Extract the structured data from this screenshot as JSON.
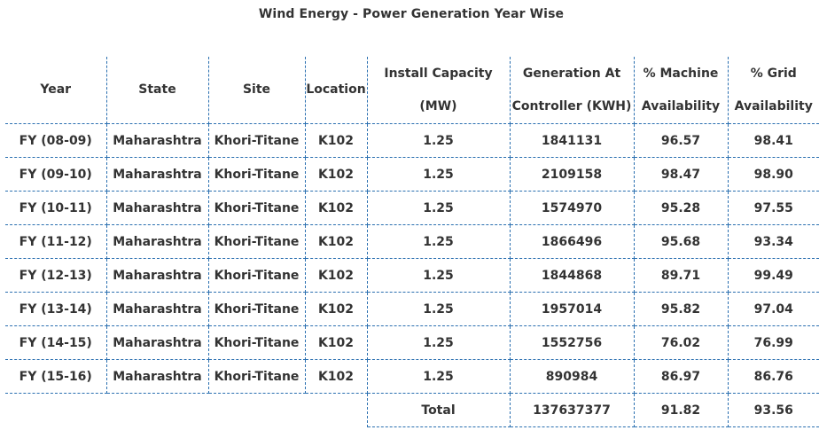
{
  "title": "Wind Energy - Power Generation Year Wise",
  "headers": {
    "year": "Year",
    "state": "State",
    "site": "Site",
    "location": "Location",
    "capacity_line1": "Install Capacity",
    "capacity_line2": "(MW)",
    "generation_line1": "Generation At",
    "generation_line2": "Controller (KWH)",
    "machine_line1": "% Machine",
    "machine_line2": "Availability",
    "grid_line1": "% Grid",
    "grid_line2": "Availability"
  },
  "rows": [
    {
      "year": "FY (08-09)",
      "state": "Maharashtra",
      "site": "Khori-Titane",
      "location": "K102",
      "capacity": "1.25",
      "generation": "1841131",
      "machine": "96.57",
      "grid": "98.41"
    },
    {
      "year": "FY (09-10)",
      "state": "Maharashtra",
      "site": "Khori-Titane",
      "location": "K102",
      "capacity": "1.25",
      "generation": "2109158",
      "machine": "98.47",
      "grid": "98.90"
    },
    {
      "year": "FY (10-11)",
      "state": "Maharashtra",
      "site": "Khori-Titane",
      "location": "K102",
      "capacity": "1.25",
      "generation": "1574970",
      "machine": "95.28",
      "grid": "97.55"
    },
    {
      "year": "FY (11-12)",
      "state": "Maharashtra",
      "site": "Khori-Titane",
      "location": "K102",
      "capacity": "1.25",
      "generation": "1866496",
      "machine": "95.68",
      "grid": "93.34"
    },
    {
      "year": "FY (12-13)",
      "state": "Maharashtra",
      "site": "Khori-Titane",
      "location": "K102",
      "capacity": "1.25",
      "generation": "1844868",
      "machine": "89.71",
      "grid": "99.49"
    },
    {
      "year": "FY (13-14)",
      "state": "Maharashtra",
      "site": "Khori-Titane",
      "location": "K102",
      "capacity": "1.25",
      "generation": "1957014",
      "machine": "95.82",
      "grid": "97.04"
    },
    {
      "year": "FY (14-15)",
      "state": "Maharashtra",
      "site": "Khori-Titane",
      "location": "K102",
      "capacity": "1.25",
      "generation": "1552756",
      "machine": "76.02",
      "grid": "76.99"
    },
    {
      "year": "FY (15-16)",
      "state": "Maharashtra",
      "site": "Khori-Titane",
      "location": "K102",
      "capacity": "1.25",
      "generation": "890984",
      "machine": "86.97",
      "grid": "86.76"
    }
  ],
  "total": {
    "label": "Total",
    "generation": "137637377",
    "machine": "91.82",
    "grid": "93.56"
  }
}
